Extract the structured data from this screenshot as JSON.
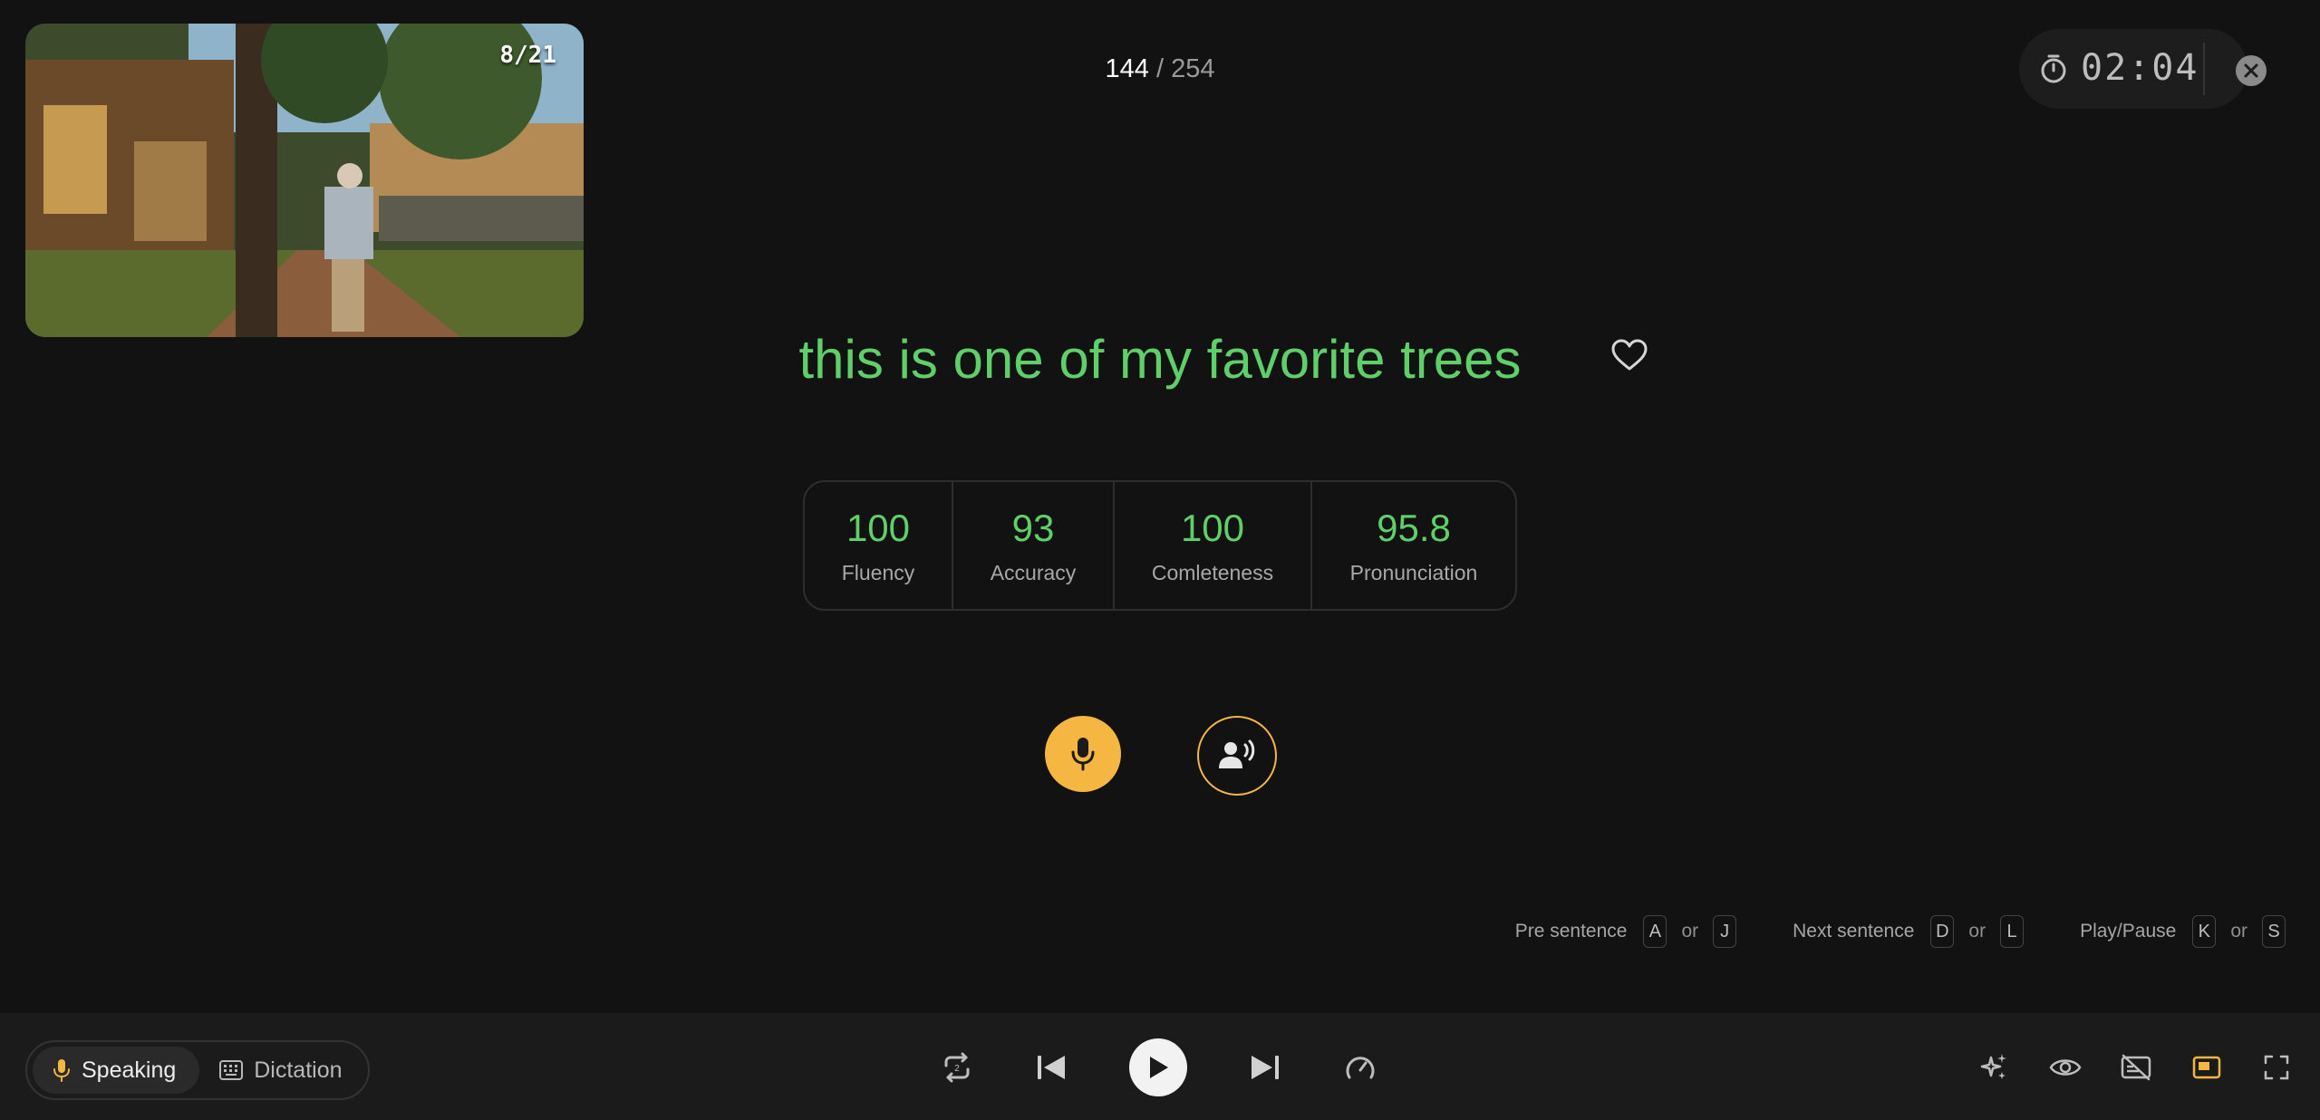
{
  "video": {
    "counter": "8/21"
  },
  "progress": {
    "current": "144",
    "separator": "/",
    "total": "254"
  },
  "timer": {
    "value": "02:04"
  },
  "sentence": {
    "text": "this is one of my favorite trees"
  },
  "scores": [
    {
      "value": "100",
      "label": "Fluency"
    },
    {
      "value": "93",
      "label": "Accuracy"
    },
    {
      "value": "100",
      "label": "Comleteness"
    },
    {
      "value": "95.8",
      "label": "Pronunciation"
    }
  ],
  "shortcuts": [
    {
      "label": "Pre sentence",
      "key1": "A",
      "or": "or",
      "key2": "J"
    },
    {
      "label": "Next sentence",
      "key1": "D",
      "or": "or",
      "key2": "L"
    },
    {
      "label": "Play/Pause",
      "key1": "K",
      "or": "or",
      "key2": "S"
    }
  ],
  "modes": {
    "speaking": "Speaking",
    "dictation": "Dictation"
  },
  "colors": {
    "accent": "#f5b642",
    "score_green": "#5fcf6a",
    "background": "#121212",
    "bar": "#1b1b1b"
  }
}
